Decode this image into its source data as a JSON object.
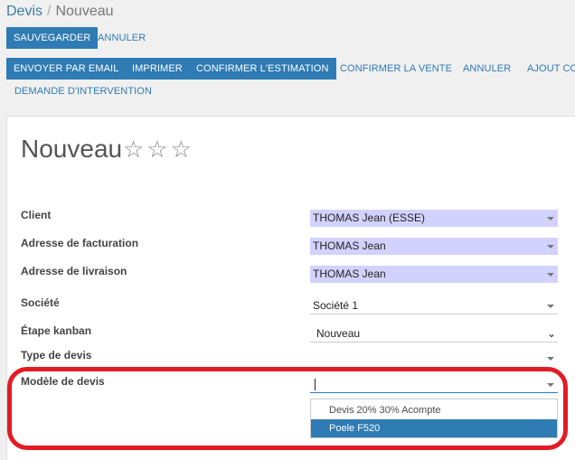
{
  "breadcrumb": {
    "parent": "Devis",
    "separator": "/",
    "current": "Nouveau"
  },
  "control": {
    "save": "SAUVEGARDER",
    "discard": "ANNULER"
  },
  "status_buttons": {
    "send_email": "ENVOYER PAR EMAIL",
    "print": "IMPRIMER",
    "confirm_estimate": "CONFIRMER L'ESTIMATION",
    "confirm_sale": "CONFIRMER LA VENTE",
    "cancel": "ANNULER",
    "add_co": "AJOUT CO",
    "intervention_request": "DEMANDE D'INTERVENTION"
  },
  "form": {
    "title": "Nouveau",
    "stars": "☆☆☆",
    "fields": {
      "client": {
        "label": "Client",
        "value": "THOMAS Jean (ESSE)"
      },
      "billing": {
        "label": "Adresse de facturation",
        "value": "THOMAS Jean"
      },
      "shipping": {
        "label": "Adresse de livraison",
        "value": "THOMAS Jean"
      },
      "company": {
        "label": "Société",
        "value": "Société 1"
      },
      "kanban": {
        "label": "Étape kanban",
        "value": "Nouveau"
      },
      "quote_type": {
        "label": "Type de devis",
        "value": ""
      },
      "template": {
        "label": "Modèle de devis",
        "value": ""
      }
    },
    "template_options": [
      "Devis 20% 30% Acompte",
      "Poele F520"
    ],
    "highlight_color": "#e31b23"
  }
}
